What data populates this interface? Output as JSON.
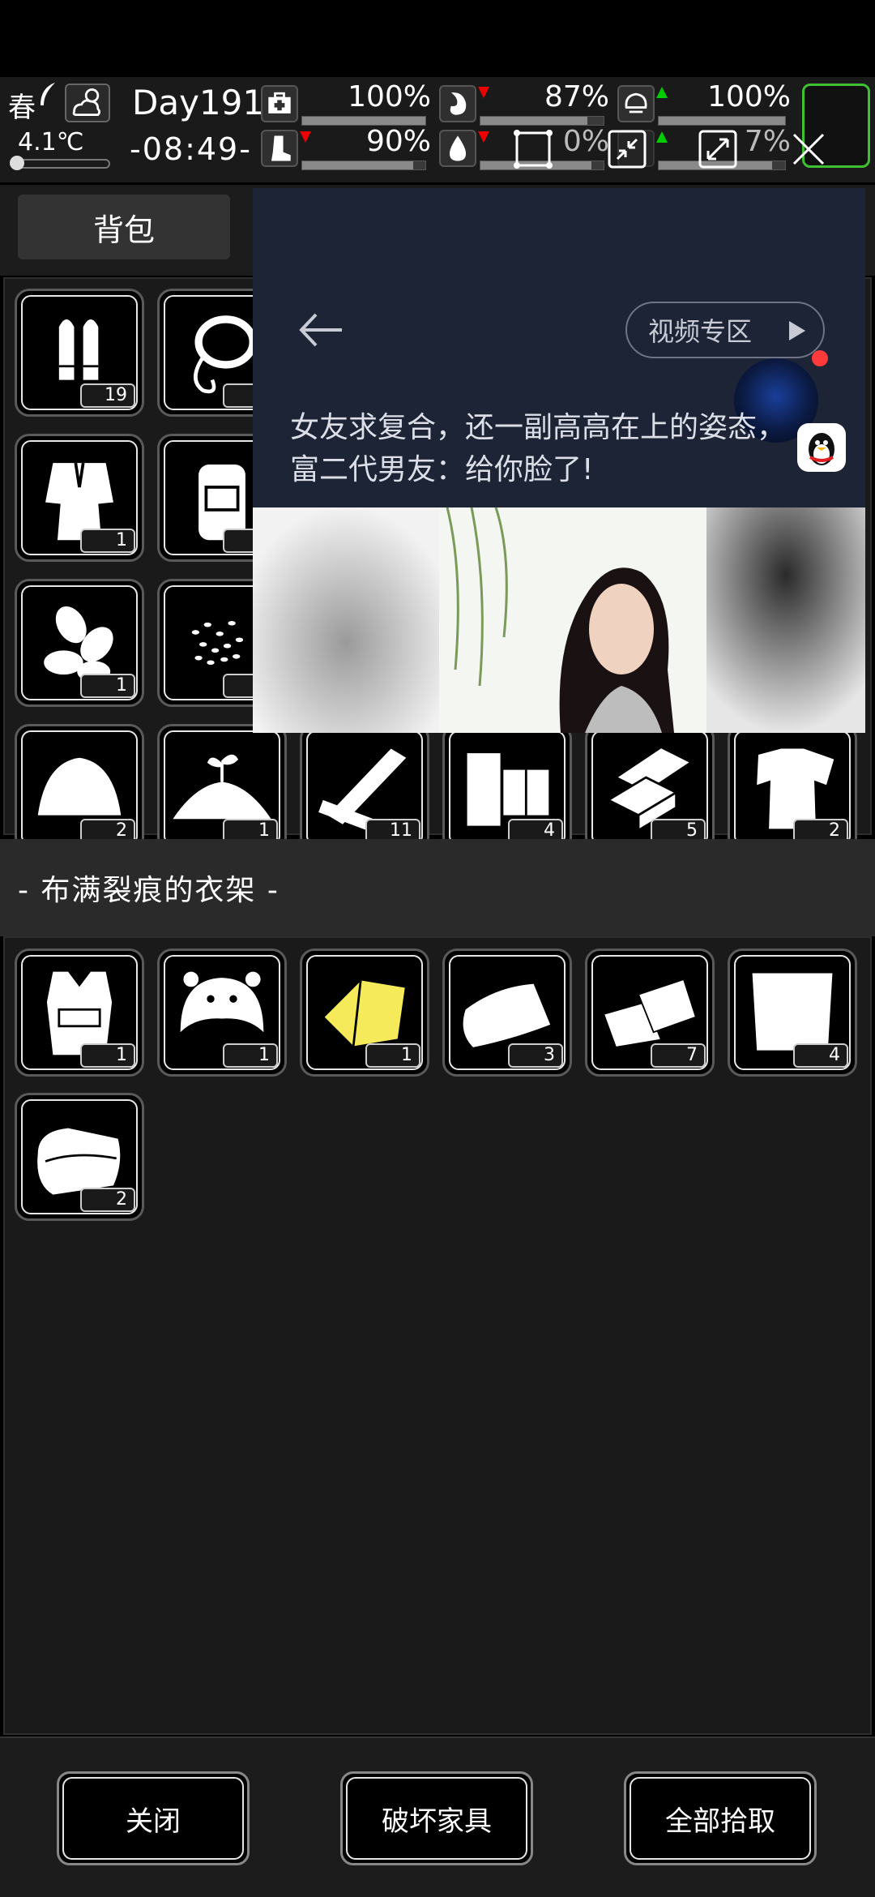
{
  "hud": {
    "season": "春",
    "temperature": "4.1℃",
    "day": "Day191",
    "time": "-08:49-",
    "stats": [
      {
        "name": "health",
        "value": "100%",
        "level": 1.0
      },
      {
        "name": "hunger",
        "value": "87%",
        "level": 0.87,
        "trend": "down"
      },
      {
        "name": "mood",
        "value": "100%",
        "level": 1.0,
        "trend": "up"
      },
      {
        "name": "stamina",
        "value": "90%",
        "level": 0.9,
        "trend": "down"
      },
      {
        "name": "thirst",
        "value": "0%",
        "level": 0.9,
        "trend": "down"
      },
      {
        "name": "clean",
        "value": "7%",
        "level": 0.9,
        "trend": "up"
      }
    ],
    "stat_values_partial": {
      "thirst": "0%",
      "clean": "7%"
    }
  },
  "tabs": {
    "backpack": "背包"
  },
  "backpack": {
    "items": [
      {
        "icon": "bullets-icon",
        "count": "19"
      },
      {
        "icon": "rope-icon",
        "count": "1"
      },
      {
        "icon": "fur-coat-icon",
        "count": "1"
      },
      {
        "icon": "hiking-backpack-icon",
        "count": "1"
      },
      {
        "icon": "almonds-icon",
        "count": "1"
      },
      {
        "icon": "seeds-icon",
        "count": "1"
      },
      {
        "icon": "hay-pile-icon",
        "count": "2"
      },
      {
        "icon": "sprout-soil-icon",
        "count": "1"
      },
      {
        "icon": "planks-icon",
        "count": "11"
      },
      {
        "icon": "logs-icon",
        "count": "4"
      },
      {
        "icon": "wood-blocks-icon",
        "count": "5"
      },
      {
        "icon": "torn-shirt-icon",
        "count": "2"
      }
    ]
  },
  "container": {
    "title": "-  布满裂痕的衣架  -",
    "items": [
      {
        "icon": "vest-icon",
        "count": "1"
      },
      {
        "icon": "animal-hat-icon",
        "count": "1"
      },
      {
        "icon": "yellow-cloth-icon",
        "count": "1",
        "color": "#f4ea5a"
      },
      {
        "icon": "towel-icon",
        "count": "3"
      },
      {
        "icon": "cloth-rags-icon",
        "count": "7"
      },
      {
        "icon": "linen-icon",
        "count": "4"
      },
      {
        "icon": "folded-clothes-icon",
        "count": "2"
      }
    ]
  },
  "buttons": {
    "close": "关闭",
    "destroy": "破坏家具",
    "take_all": "全部拾取"
  },
  "overlay": {
    "video_zone": "视频专区",
    "title": "女友求复合，还一副高高在上的姿态，富二代男友：给你脸了!"
  },
  "colors": {
    "accent_green": "#3fc030",
    "arrow_red": "#e00000",
    "arrow_green": "#00c000",
    "overlay_bg": "#1d2436"
  }
}
